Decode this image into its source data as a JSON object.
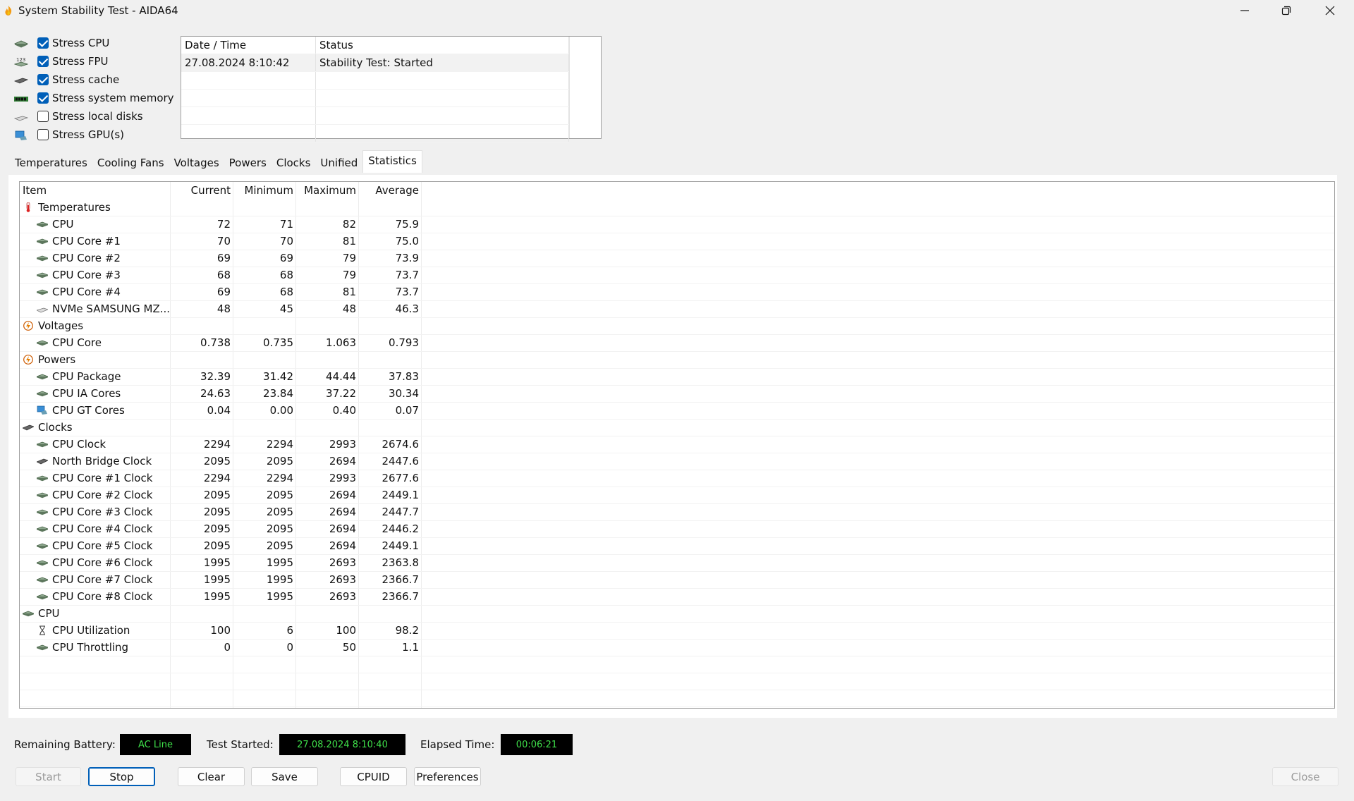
{
  "window": {
    "title": "System Stability Test - AIDA64",
    "controls": [
      "minimize",
      "maximize",
      "close"
    ]
  },
  "stress_options": [
    {
      "label": "Stress CPU",
      "checked": true,
      "icon": "cpu-chip-icon"
    },
    {
      "label": "Stress FPU",
      "checked": true,
      "icon": "fpu-123-icon"
    },
    {
      "label": "Stress cache",
      "checked": true,
      "icon": "cache-chip-icon"
    },
    {
      "label": "Stress system memory",
      "checked": true,
      "icon": "memory-module-icon"
    },
    {
      "label": "Stress local disks",
      "checked": false,
      "icon": "disk-drive-icon"
    },
    {
      "label": "Stress GPU(s)",
      "checked": false,
      "icon": "gpu-monitor-icon"
    }
  ],
  "log": {
    "headers": [
      "Date / Time",
      "Status"
    ],
    "rows": [
      {
        "datetime": "27.08.2024 8:10:42",
        "status": "Stability Test: Started"
      }
    ]
  },
  "tabs": {
    "items": [
      "Temperatures",
      "Cooling Fans",
      "Voltages",
      "Powers",
      "Clocks",
      "Unified",
      "Statistics"
    ],
    "active": "Statistics"
  },
  "statistics": {
    "headers": {
      "item": "Item",
      "current": "Current",
      "minimum": "Minimum",
      "maximum": "Maximum",
      "average": "Average"
    },
    "rows": [
      {
        "type": "category",
        "icon": "thermometer-icon",
        "item": "Temperatures"
      },
      {
        "type": "item",
        "icon": "cpu-chip-icon",
        "item": "CPU",
        "current": "72",
        "minimum": "71",
        "maximum": "82",
        "average": "75.9"
      },
      {
        "type": "item",
        "icon": "cpu-chip-icon",
        "item": "CPU Core #1",
        "current": "70",
        "minimum": "70",
        "maximum": "81",
        "average": "75.0"
      },
      {
        "type": "item",
        "icon": "cpu-chip-icon",
        "item": "CPU Core #2",
        "current": "69",
        "minimum": "69",
        "maximum": "79",
        "average": "73.9"
      },
      {
        "type": "item",
        "icon": "cpu-chip-icon",
        "item": "CPU Core #3",
        "current": "68",
        "minimum": "68",
        "maximum": "79",
        "average": "73.7"
      },
      {
        "type": "item",
        "icon": "cpu-chip-icon",
        "item": "CPU Core #4",
        "current": "69",
        "minimum": "68",
        "maximum": "81",
        "average": "73.7"
      },
      {
        "type": "item",
        "icon": "disk-drive-icon",
        "item": "NVMe SAMSUNG MZ...",
        "current": "48",
        "minimum": "45",
        "maximum": "48",
        "average": "46.3"
      },
      {
        "type": "category",
        "icon": "lightning-icon",
        "item": "Voltages"
      },
      {
        "type": "item",
        "icon": "cpu-chip-icon",
        "item": "CPU Core",
        "current": "0.738",
        "minimum": "0.735",
        "maximum": "1.063",
        "average": "0.793"
      },
      {
        "type": "category",
        "icon": "lightning-icon",
        "item": "Powers"
      },
      {
        "type": "item",
        "icon": "cpu-chip-icon",
        "item": "CPU Package",
        "current": "32.39",
        "minimum": "31.42",
        "maximum": "44.44",
        "average": "37.83"
      },
      {
        "type": "item",
        "icon": "cpu-chip-icon",
        "item": "CPU IA Cores",
        "current": "24.63",
        "minimum": "23.84",
        "maximum": "37.22",
        "average": "30.34"
      },
      {
        "type": "item",
        "icon": "gpu-monitor-icon",
        "item": "CPU GT Cores",
        "current": "0.04",
        "minimum": "0.00",
        "maximum": "0.40",
        "average": "0.07"
      },
      {
        "type": "category",
        "icon": "cache-chip-icon",
        "item": "Clocks"
      },
      {
        "type": "item",
        "icon": "cpu-chip-icon",
        "item": "CPU Clock",
        "current": "2294",
        "minimum": "2294",
        "maximum": "2993",
        "average": "2674.6"
      },
      {
        "type": "item",
        "icon": "cache-chip-icon",
        "item": "North Bridge Clock",
        "current": "2095",
        "minimum": "2095",
        "maximum": "2694",
        "average": "2447.6"
      },
      {
        "type": "item",
        "icon": "cpu-chip-icon",
        "item": "CPU Core #1 Clock",
        "current": "2294",
        "minimum": "2294",
        "maximum": "2993",
        "average": "2677.6"
      },
      {
        "type": "item",
        "icon": "cpu-chip-icon",
        "item": "CPU Core #2 Clock",
        "current": "2095",
        "minimum": "2095",
        "maximum": "2694",
        "average": "2449.1"
      },
      {
        "type": "item",
        "icon": "cpu-chip-icon",
        "item": "CPU Core #3 Clock",
        "current": "2095",
        "minimum": "2095",
        "maximum": "2694",
        "average": "2447.7"
      },
      {
        "type": "item",
        "icon": "cpu-chip-icon",
        "item": "CPU Core #4 Clock",
        "current": "2095",
        "minimum": "2095",
        "maximum": "2694",
        "average": "2446.2"
      },
      {
        "type": "item",
        "icon": "cpu-chip-icon",
        "item": "CPU Core #5 Clock",
        "current": "2095",
        "minimum": "2095",
        "maximum": "2694",
        "average": "2449.1"
      },
      {
        "type": "item",
        "icon": "cpu-chip-icon",
        "item": "CPU Core #6 Clock",
        "current": "1995",
        "minimum": "1995",
        "maximum": "2693",
        "average": "2363.8"
      },
      {
        "type": "item",
        "icon": "cpu-chip-icon",
        "item": "CPU Core #7 Clock",
        "current": "1995",
        "minimum": "1995",
        "maximum": "2693",
        "average": "2366.7"
      },
      {
        "type": "item",
        "icon": "cpu-chip-icon",
        "item": "CPU Core #8 Clock",
        "current": "1995",
        "minimum": "1995",
        "maximum": "2693",
        "average": "2366.7"
      },
      {
        "type": "category",
        "icon": "cpu-chip-icon",
        "item": "CPU"
      },
      {
        "type": "item",
        "icon": "hourglass-icon",
        "item": "CPU Utilization",
        "current": "100",
        "minimum": "6",
        "maximum": "100",
        "average": "98.2"
      },
      {
        "type": "item",
        "icon": "cpu-chip-icon",
        "item": "CPU Throttling",
        "current": "0",
        "minimum": "0",
        "maximum": "50",
        "average": "1.1"
      }
    ]
  },
  "status_bar": {
    "battery_label": "Remaining Battery:",
    "battery_value": "AC Line",
    "started_label": "Test Started:",
    "started_value": "27.08.2024 8:10:40",
    "elapsed_label": "Elapsed Time:",
    "elapsed_value": "00:06:21",
    "value_color": "#3fe04a"
  },
  "buttons": {
    "start": "Start",
    "stop": "Stop",
    "clear": "Clear",
    "save": "Save",
    "cpuid": "CPUID",
    "preferences": "Preferences",
    "close": "Close"
  },
  "colors": {
    "accent": "#005fb8",
    "background": "#f0f0f0",
    "panel": "#ffffff"
  }
}
